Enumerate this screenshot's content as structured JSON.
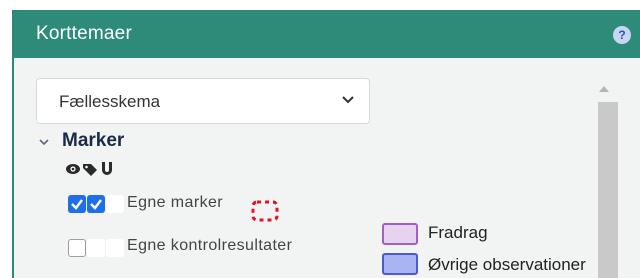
{
  "header": {
    "title": "Korttemaer",
    "help_icon": "help-icon"
  },
  "dropdown": {
    "selected": "Fællesskema"
  },
  "section": {
    "title": "Marker",
    "expanded": true
  },
  "column_icons": [
    "eye-icon",
    "tag-icon",
    "magnet-icon"
  ],
  "layers": [
    {
      "label": "Egne marker",
      "checks": [
        true,
        true,
        false
      ],
      "symbol": "red-dashed-outline"
    },
    {
      "label": "Egne kontrolresultater",
      "checks": [
        false,
        false,
        false
      ]
    }
  ],
  "legend": [
    {
      "label": "Fradrag",
      "fill": "#e8d3ee",
      "border": "#a15fc3"
    },
    {
      "label": "Øvrige observationer",
      "fill": "#a9b4f3",
      "border": "#4b5bd6"
    }
  ],
  "colors": {
    "header": "#2e8b79",
    "checkbox": "#1f6feb",
    "marker_outline": "#e0141e"
  }
}
